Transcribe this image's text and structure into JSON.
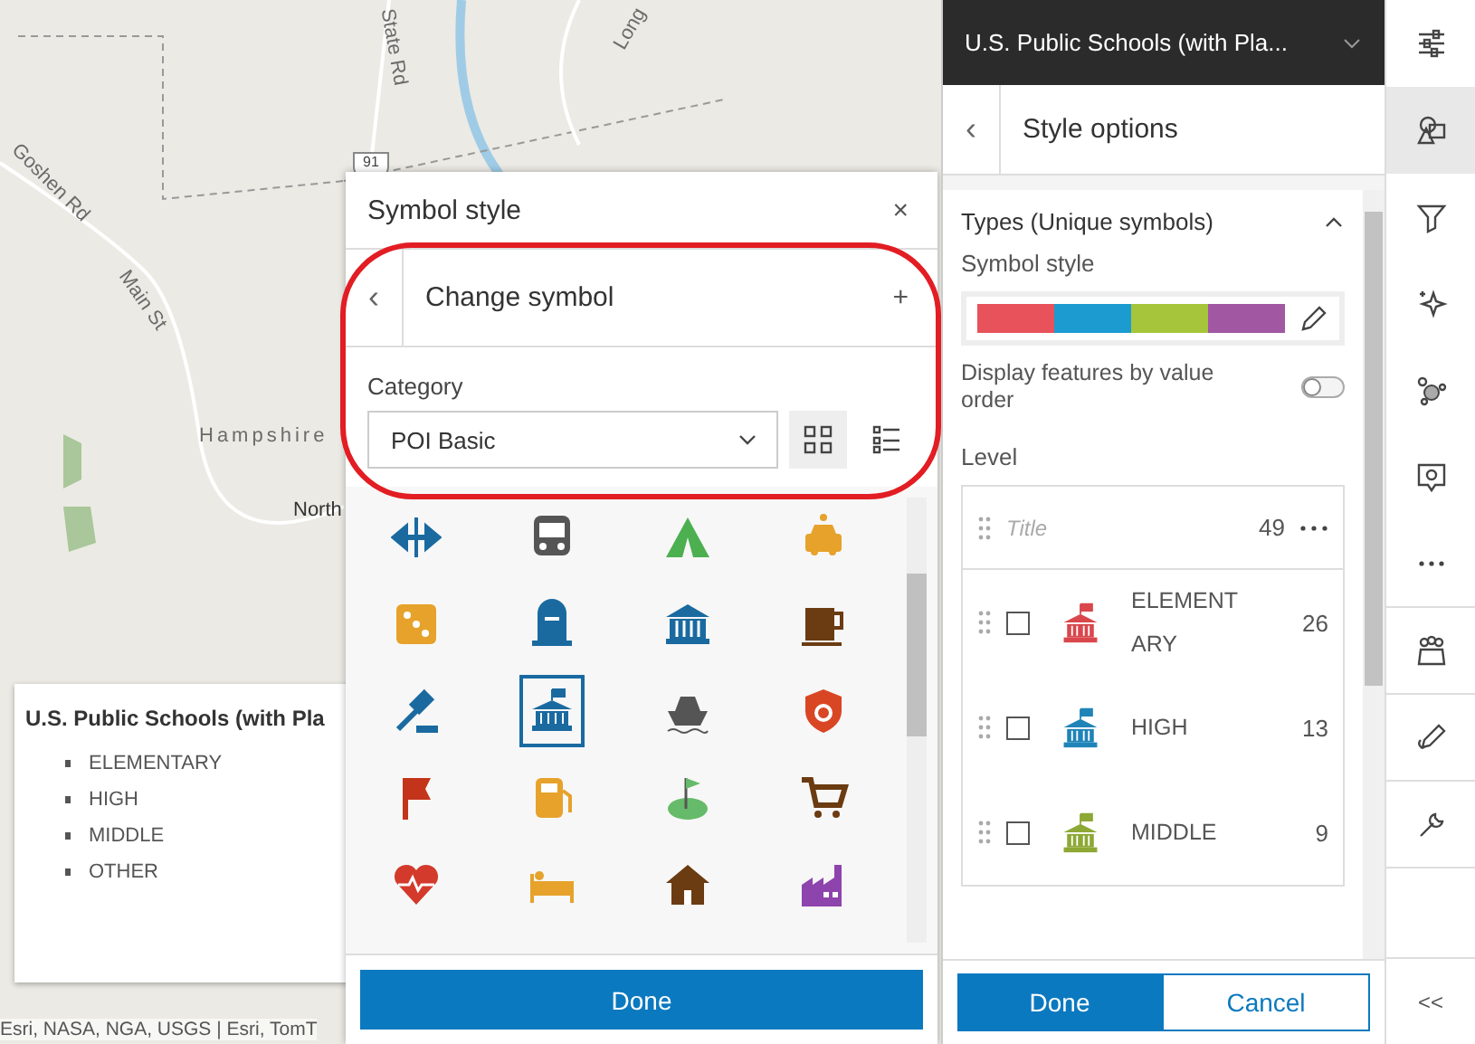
{
  "map": {
    "labels": [
      "State Rd",
      "Long",
      "Goshen Rd",
      "Main St",
      "Hampshire",
      "North"
    ],
    "shield": "91",
    "attribution": "Esri, NASA, NGA, USGS | Esri, TomT"
  },
  "legend": {
    "title": "U.S. Public Schools (with Pla",
    "items": [
      "ELEMENTARY",
      "HIGH",
      "MIDDLE",
      "OTHER"
    ]
  },
  "symbol_dialog": {
    "title": "Symbol style",
    "close": "×",
    "subheader": {
      "back": "‹",
      "title": "Change symbol",
      "add": "+"
    },
    "category": {
      "label": "Category",
      "value": "POI Basic"
    },
    "views": [
      {
        "kind": "grid",
        "selected": true
      },
      {
        "kind": "list",
        "selected": false
      }
    ],
    "symbols": [
      {
        "selected": false
      },
      {
        "selected": false
      },
      {
        "selected": false
      },
      {
        "selected": false
      },
      {
        "selected": false
      },
      {
        "selected": false
      },
      {
        "selected": false
      },
      {
        "selected": false
      },
      {
        "selected": false
      },
      {
        "selected": true
      },
      {
        "selected": false
      },
      {
        "selected": false
      },
      {
        "selected": false
      },
      {
        "selected": false
      },
      {
        "selected": false
      },
      {
        "selected": false
      },
      {
        "selected": false
      },
      {
        "selected": false
      },
      {
        "selected": false
      },
      {
        "selected": false
      }
    ],
    "done": "Done"
  },
  "style_panel": {
    "layer_title": "U.S. Public Schools (with Pla...",
    "back": "‹",
    "title": "Style options",
    "section": {
      "title": "Types (Unique symbols)",
      "expanded": true
    },
    "symbol_style_label": "Symbol style",
    "toggle": {
      "label": "Display features by value order",
      "on": false
    },
    "level_label": "Level",
    "list": {
      "title_placeholder": "Title",
      "total": "49",
      "rows": [
        {
          "label": "ELEMENTARY",
          "count": "26",
          "checked": false,
          "color": "#d9474c"
        },
        {
          "label": "HIGH",
          "count": "13",
          "checked": false,
          "color": "#1f84b8"
        },
        {
          "label": "MIDDLE",
          "count": "9",
          "checked": false,
          "color": "#8da835"
        }
      ]
    },
    "done": "Done",
    "cancel": "Cancel"
  },
  "rail": [
    {
      "kind": "sliders",
      "selected": false
    },
    {
      "kind": "shapes",
      "selected": true
    },
    {
      "kind": "filter",
      "selected": false
    },
    {
      "kind": "sparkle",
      "selected": false
    },
    {
      "kind": "cluster",
      "selected": false
    },
    {
      "kind": "popup",
      "selected": false
    },
    {
      "kind": "more",
      "selected": false
    },
    {
      "kind": "people",
      "selected": false
    },
    {
      "kind": "pencil",
      "selected": false
    },
    {
      "kind": "wrench",
      "selected": false
    }
  ],
  "rail_collapse": "<<"
}
